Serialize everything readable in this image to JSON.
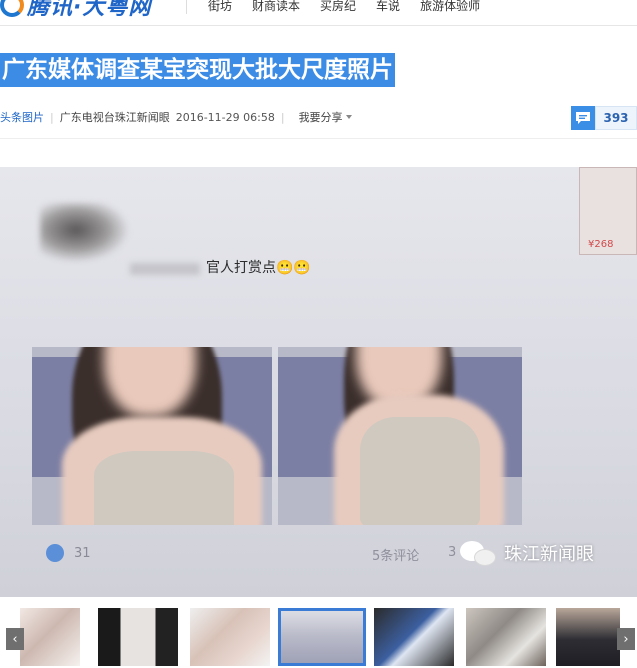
{
  "header": {
    "site_name": "腾讯·大粤网",
    "nav_items": [
      "街坊",
      "财商读本",
      "买房纪",
      "车说",
      "旅游体验师"
    ]
  },
  "article": {
    "title": "广东媒体调查某宝突现大批大尺度照片",
    "category": "头条图片",
    "source": "广东电视台珠江新闻眼",
    "datetime": "2016-11-29 06:58",
    "share_label": "我要分享",
    "comment_count": "393"
  },
  "photo": {
    "reward_text": "官人打赏点😬😬",
    "like_count": "31",
    "comments_text": "5条评论",
    "comments_trailing": "3",
    "watermark": "珠江新闻眼",
    "corner_price": "¥268"
  },
  "gallery": {
    "prev_label": "‹",
    "next_label": "›",
    "active_index": 3
  },
  "colors": {
    "brand_blue": "#1f66c8",
    "title_highlight": "#3c8ce6",
    "comment_blue": "#3a8ee6"
  }
}
